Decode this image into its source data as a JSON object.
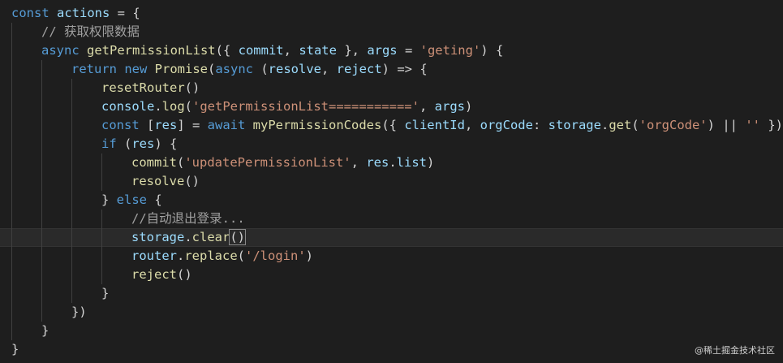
{
  "editor": {
    "lines": [
      {
        "indent": 0,
        "tokens": [
          {
            "t": "const ",
            "c": "t-kw"
          },
          {
            "t": "actions",
            "c": "t-name"
          },
          {
            "t": " = {",
            "c": "t-plain"
          }
        ]
      },
      {
        "indent": 1,
        "tokens": [
          {
            "t": "// 获取权限数据",
            "c": "t-cmt"
          }
        ]
      },
      {
        "indent": 1,
        "tokens": [
          {
            "t": "async ",
            "c": "t-kw"
          },
          {
            "t": "getPermissionList",
            "c": "t-func"
          },
          {
            "t": "({ ",
            "c": "t-plain"
          },
          {
            "t": "commit",
            "c": "t-name"
          },
          {
            "t": ", ",
            "c": "t-plain"
          },
          {
            "t": "state",
            "c": "t-name"
          },
          {
            "t": " }, ",
            "c": "t-plain"
          },
          {
            "t": "args",
            "c": "t-name"
          },
          {
            "t": " = ",
            "c": "t-plain"
          },
          {
            "t": "'geting'",
            "c": "t-str"
          },
          {
            "t": ") {",
            "c": "t-plain"
          }
        ]
      },
      {
        "indent": 2,
        "tokens": [
          {
            "t": "return ",
            "c": "t-kw"
          },
          {
            "t": "new ",
            "c": "t-kw"
          },
          {
            "t": "Promise",
            "c": "t-func"
          },
          {
            "t": "(",
            "c": "t-plain"
          },
          {
            "t": "async ",
            "c": "t-kw"
          },
          {
            "t": "(",
            "c": "t-plain"
          },
          {
            "t": "resolve",
            "c": "t-name"
          },
          {
            "t": ", ",
            "c": "t-plain"
          },
          {
            "t": "reject",
            "c": "t-name"
          },
          {
            "t": ") => {",
            "c": "t-plain"
          }
        ]
      },
      {
        "indent": 3,
        "tokens": [
          {
            "t": "resetRouter",
            "c": "t-func"
          },
          {
            "t": "()",
            "c": "t-plain"
          }
        ]
      },
      {
        "indent": 3,
        "tokens": [
          {
            "t": "console",
            "c": "t-name"
          },
          {
            "t": ".",
            "c": "t-plain"
          },
          {
            "t": "log",
            "c": "t-func"
          },
          {
            "t": "(",
            "c": "t-plain"
          },
          {
            "t": "'getPermissionList==========='",
            "c": "t-str"
          },
          {
            "t": ", ",
            "c": "t-plain"
          },
          {
            "t": "args",
            "c": "t-name"
          },
          {
            "t": ")",
            "c": "t-plain"
          }
        ]
      },
      {
        "indent": 3,
        "tokens": [
          {
            "t": "const ",
            "c": "t-kw"
          },
          {
            "t": "[",
            "c": "t-plain"
          },
          {
            "t": "res",
            "c": "t-name"
          },
          {
            "t": "] = ",
            "c": "t-plain"
          },
          {
            "t": "await ",
            "c": "t-kw"
          },
          {
            "t": "myPermissionCodes",
            "c": "t-func"
          },
          {
            "t": "({ ",
            "c": "t-plain"
          },
          {
            "t": "clientId",
            "c": "t-name"
          },
          {
            "t": ", ",
            "c": "t-plain"
          },
          {
            "t": "orgCode",
            "c": "t-name"
          },
          {
            "t": ": ",
            "c": "t-plain"
          },
          {
            "t": "storage",
            "c": "t-name"
          },
          {
            "t": ".",
            "c": "t-plain"
          },
          {
            "t": "get",
            "c": "t-func"
          },
          {
            "t": "(",
            "c": "t-plain"
          },
          {
            "t": "'orgCode'",
            "c": "t-str"
          },
          {
            "t": ") || ",
            "c": "t-plain"
          },
          {
            "t": "''",
            "c": "t-str"
          },
          {
            "t": " })",
            "c": "t-plain"
          }
        ]
      },
      {
        "indent": 3,
        "tokens": [
          {
            "t": "if ",
            "c": "t-kw"
          },
          {
            "t": "(",
            "c": "t-plain"
          },
          {
            "t": "res",
            "c": "t-name"
          },
          {
            "t": ") {",
            "c": "t-plain"
          }
        ]
      },
      {
        "indent": 4,
        "tokens": [
          {
            "t": "commit",
            "c": "t-func"
          },
          {
            "t": "(",
            "c": "t-plain"
          },
          {
            "t": "'updatePermissionList'",
            "c": "t-str"
          },
          {
            "t": ", ",
            "c": "t-plain"
          },
          {
            "t": "res",
            "c": "t-name"
          },
          {
            "t": ".",
            "c": "t-plain"
          },
          {
            "t": "list",
            "c": "t-name"
          },
          {
            "t": ")",
            "c": "t-plain"
          }
        ]
      },
      {
        "indent": 4,
        "tokens": [
          {
            "t": "resolve",
            "c": "t-func"
          },
          {
            "t": "()",
            "c": "t-plain"
          }
        ]
      },
      {
        "indent": 3,
        "tokens": [
          {
            "t": "} ",
            "c": "t-plain"
          },
          {
            "t": "else ",
            "c": "t-kw"
          },
          {
            "t": "{",
            "c": "t-plain"
          }
        ]
      },
      {
        "indent": 4,
        "tokens": [
          {
            "t": "//自动退出登录...",
            "c": "t-cmt"
          }
        ]
      },
      {
        "indent": 4,
        "active": true,
        "tokens": [
          {
            "t": "storage",
            "c": "t-name"
          },
          {
            "t": ".",
            "c": "t-plain"
          },
          {
            "t": "clear",
            "c": "t-func"
          },
          {
            "t": "()",
            "c": "t-plain cursor-box"
          }
        ]
      },
      {
        "indent": 4,
        "tokens": [
          {
            "t": "router",
            "c": "t-name"
          },
          {
            "t": ".",
            "c": "t-plain"
          },
          {
            "t": "replace",
            "c": "t-func"
          },
          {
            "t": "(",
            "c": "t-plain"
          },
          {
            "t": "'/login'",
            "c": "t-str"
          },
          {
            "t": ")",
            "c": "t-plain"
          }
        ]
      },
      {
        "indent": 4,
        "tokens": [
          {
            "t": "reject",
            "c": "t-func"
          },
          {
            "t": "()",
            "c": "t-plain"
          }
        ]
      },
      {
        "indent": 3,
        "tokens": [
          {
            "t": "}",
            "c": "t-plain"
          }
        ]
      },
      {
        "indent": 2,
        "tokens": [
          {
            "t": "})",
            "c": "t-plain"
          }
        ]
      },
      {
        "indent": 1,
        "tokens": [
          {
            "t": "}",
            "c": "t-plain"
          }
        ]
      },
      {
        "indent": 0,
        "tokens": [
          {
            "t": "}",
            "c": "t-plain"
          }
        ]
      }
    ]
  },
  "watermark": "@稀土掘金技术社区"
}
